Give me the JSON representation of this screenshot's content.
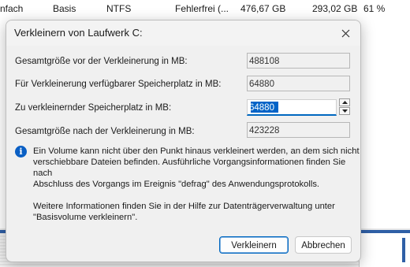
{
  "background_row": {
    "col1": "nfach",
    "col2": "Basis",
    "col3": "NTFS",
    "col4": "Fehlerfrei (...",
    "col5": "476,67 GB",
    "col6": "293,02 GB",
    "col7": "61 %"
  },
  "dialog": {
    "title": "Verkleinern von Laufwerk C:",
    "fields": {
      "total_before_label": "Gesamtgröße vor der Verkleinerung in MB:",
      "total_before_value": "488108",
      "available_label": "Für Verkleinerung verfügbarer Speicherplatz in MB:",
      "available_value": "64880",
      "shrink_label": "Zu verkleinernder Speicherplatz in MB:",
      "shrink_value": "64880",
      "total_after_label": "Gesamtgröße nach der Verkleinerung in MB:",
      "total_after_value": "423228"
    },
    "info": {
      "line1": "Ein Volume kann nicht über den Punkt hinaus verkleinert werden, an dem sich nicht",
      "line2": "verschiebbare Dateien befinden. Ausführliche Vorgangsinformationen finden Sie nach",
      "line3": "Abschluss des Vorgangs im Ereignis \"defrag\" des Anwendungsprotokolls."
    },
    "help": {
      "line1": "Weitere Informationen finden Sie in der Hilfe zur Datenträgerverwaltung unter",
      "line2": "\"Basisvolume verkleinern\"."
    },
    "buttons": {
      "shrink": "Verkleinern",
      "cancel": "Abbrechen"
    }
  }
}
